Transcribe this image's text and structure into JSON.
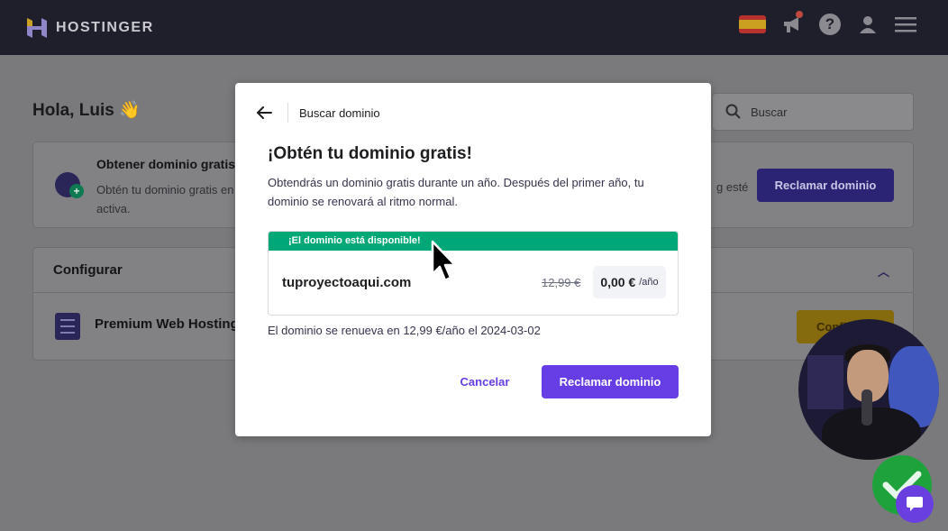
{
  "topbar": {
    "brand": "HOSTINGER",
    "icons": [
      "spain-flag-icon",
      "megaphone-icon",
      "help-icon",
      "user-icon",
      "menu-icon"
    ]
  },
  "background": {
    "greeting": "Hola, Luis 👋",
    "search_placeholder": "Buscar",
    "free_domain_card": {
      "title": "Obtener dominio gratis",
      "description": "Obtén tu dominio gratis en",
      "description_cont": "activa.",
      "description_right": "g esté",
      "button": "Reclamar dominio"
    },
    "configure_card": {
      "title": "Configurar",
      "item": "Premium Web Hosting",
      "button": "Confi"
    }
  },
  "modal": {
    "breadcrumb": "Buscar dominio",
    "title": "¡Obtén tu dominio gratis!",
    "description": "Obtendrás un dominio gratis durante un año. Después del primer año, tu dominio se renovará al ritmo normal.",
    "availability": "¡El dominio está disponible!",
    "domain": "tuproyectoaqui.com",
    "old_price": "12,99 €",
    "price": "0,00 €",
    "price_unit": "/año",
    "renewal_note": "El dominio se renueva en 12,99 €/año el 2024-03-02",
    "cancel_label": "Cancelar",
    "claim_label": "Reclamar dominio"
  },
  "colors": {
    "accent": "#673de6",
    "available": "#00a878",
    "topbar": "#1f1f2b"
  }
}
